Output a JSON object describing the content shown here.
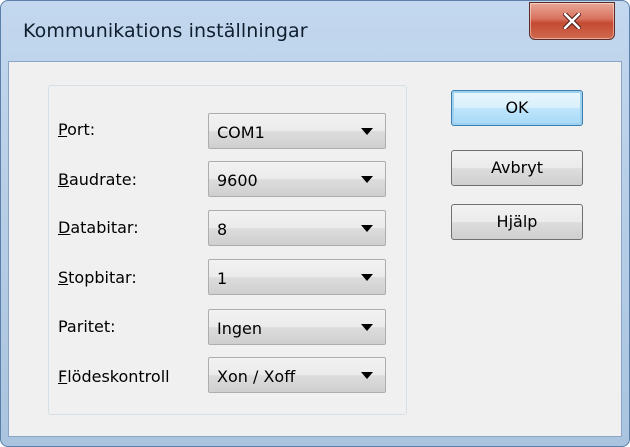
{
  "window": {
    "title": "Kommunikations inställningar",
    "close_icon": "close-icon"
  },
  "settings": [
    {
      "label": "Port:",
      "value": "COM1"
    },
    {
      "label": "Baudrate:",
      "value": "9600"
    },
    {
      "label": "Databitar:",
      "value": "8"
    },
    {
      "label": "Stopbitar:",
      "value": "1"
    },
    {
      "label": "Paritet:",
      "value": "Ingen"
    },
    {
      "label": "Flödeskontroll",
      "value": "Xon / Xoff"
    }
  ],
  "buttons": {
    "ok": "OK",
    "cancel": "Avbryt",
    "help": "Hjälp"
  },
  "colors": {
    "titlebar": "#b8cfe7",
    "close_button": "#c44a33",
    "default_button_border": "#3c7fb1"
  }
}
